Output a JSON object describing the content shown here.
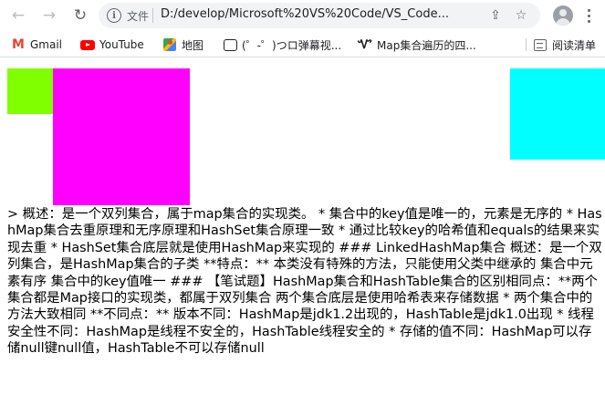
{
  "browser": {
    "omnibox": {
      "security_label": "文件",
      "url": "D:/develop/Microsoft%20VS%20Code/VS_Code..."
    },
    "bookmarks": [
      {
        "label": "Gmail",
        "icon": "gmail-icon"
      },
      {
        "label": "YouTube",
        "icon": "youtube-icon"
      },
      {
        "label": "地图",
        "icon": "maps-icon"
      },
      {
        "label": "(゜-゜)つロ弹幕视...",
        "icon": "tv-icon"
      },
      {
        "label": "Map集合遍历的四...",
        "icon": "vs-icon"
      }
    ],
    "reading_list_label": "阅读清单"
  },
  "page": {
    "boxes": {
      "green": "#7fff00",
      "magenta": "#ff00ff",
      "cyan": "#00ffff"
    },
    "text": "> 概述：是一个双列集合，属于map集合的实现类。 * 集合中的key值是唯一的，元素是无序的 * HashMap集合去重原理和无序原理和HashSet集合原理一致 * 通过比较key的哈希值和equals的结果来实现去重 * HashSet集合底层就是使用HashMap来实现的 ### LinkedHashMap集合 概述：是一个双列集合，是HashMap集合的子类 **特点：** 本类没有特殊的方法，只能使用父类中继承的 集合中元素有序 集合中的key值唯一 ### 【笔试题】HashMap集合和HashTable集合的区别相同点：**两个集合都是Map接口的实现类，都属于双列集合 两个集合底层是使用哈希表来存储数据 * 两个集合中的方法大致相同 **不同点：** 版本不同：HashMap是jdk1.2出现的，HashTable是jdk1.0出现 * 线程安全性不同：HashMap是线程不安全的，HashTable线程安全的 * 存储的值不同：HashMap可以存储null键null值，HashTable不可以存储null"
  }
}
